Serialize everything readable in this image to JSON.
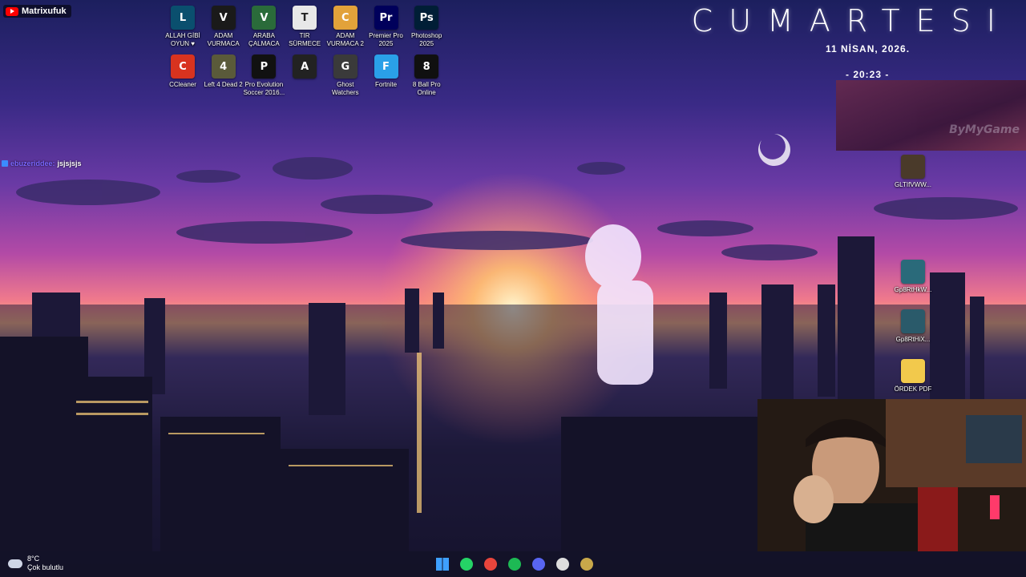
{
  "overlay": {
    "channel_name": "Matrixufuk",
    "chat": {
      "username": "ebuzeriddee:",
      "message": "jsjsjsjs"
    }
  },
  "desktop": {
    "row1": [
      {
        "label": "ALLAH GİBİ OYUN ♥",
        "icon": "league-of-legends-icon",
        "color": "#0a4f6e",
        "glyph": "L"
      },
      {
        "label": "ADAM VURMACA",
        "icon": "valorant-icon",
        "color": "#1a1a1a",
        "glyph": "V"
      },
      {
        "label": "ARABA ÇALMACA",
        "icon": "gta-v-icon",
        "color": "#2a6b3a",
        "glyph": "V"
      },
      {
        "label": "TIR SÜRMECE",
        "icon": "truck-sim-icon",
        "color": "#e8e8e8",
        "glyph": "T"
      },
      {
        "label": "ADAM VURMACA 2",
        "icon": "cs2-icon",
        "color": "#e2a23a",
        "glyph": "C"
      },
      {
        "label": "Premier Pro 2025",
        "icon": "premiere-pro-icon",
        "color": "#00005b",
        "glyph": "Pr"
      },
      {
        "label": "Photoshop 2025",
        "icon": "photoshop-icon",
        "color": "#001e36",
        "glyph": "Ps"
      }
    ],
    "row2": [
      {
        "label": "CCleaner",
        "icon": "ccleaner-icon",
        "color": "#d8331f",
        "glyph": "C"
      },
      {
        "label": "Left 4 Dead 2",
        "icon": "left4dead2-icon",
        "color": "#5a5a3a",
        "glyph": "4"
      },
      {
        "label": "Pro Evolution Soccer 2016...",
        "icon": "pes2016-icon",
        "color": "#111",
        "glyph": "P"
      },
      {
        "label": "",
        "icon": "arc-raiders-icon",
        "color": "#222",
        "glyph": "A"
      },
      {
        "label": "Ghost Watchers",
        "icon": "ghost-watchers-icon",
        "color": "#3a3a3a",
        "glyph": "G"
      },
      {
        "label": "Fortnite",
        "icon": "fortnite-icon",
        "color": "#2aa0e8",
        "glyph": "F"
      },
      {
        "label": "8 Ball Pro Online",
        "icon": "8ball-icon",
        "color": "#101010",
        "glyph": "8"
      }
    ],
    "right": [
      {
        "label": "GLTIfVWW...",
        "icon": "image-file-icon",
        "color": "#4a3a2a"
      },
      {
        "label": "Gp8RtHkW...",
        "icon": "image-file-icon",
        "color": "#2a6a7a"
      },
      {
        "label": "Gp8RtHiX...",
        "icon": "image-file-icon",
        "color": "#2a5a6a"
      },
      {
        "label": "ÖRDEK PDF",
        "icon": "folder-icon",
        "color": "#f2c94c"
      }
    ]
  },
  "widget": {
    "day": "CUMARTESI",
    "date": "11 NİSAN, 2026.",
    "time": "- 20:23 -",
    "watermark": "ByMyGame"
  },
  "taskbar": {
    "weather_temp": "8°C",
    "weather_desc": "Çok bulutlu",
    "apps": [
      {
        "name": "start-button",
        "icon": "windows-icon",
        "color": "#3ea0ff"
      },
      {
        "name": "whatsapp-button",
        "icon": "whatsapp-icon",
        "color": "#25d366"
      },
      {
        "name": "chrome-button",
        "icon": "chrome-icon",
        "color": "#e8453c"
      },
      {
        "name": "spotify-button",
        "icon": "spotify-icon",
        "color": "#1db954"
      },
      {
        "name": "discord-button",
        "icon": "discord-icon",
        "color": "#5865f2"
      },
      {
        "name": "obs-button",
        "icon": "obs-icon",
        "color": "#dddddd"
      },
      {
        "name": "league-button",
        "icon": "league-of-legends-icon",
        "color": "#c8a84a"
      }
    ]
  }
}
